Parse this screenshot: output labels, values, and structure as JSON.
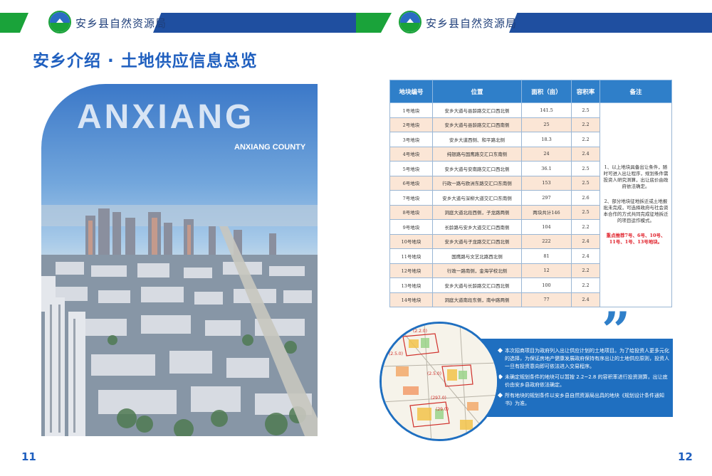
{
  "header": {
    "left_org": "安乡县自然资源局",
    "right_org": "安乡县自然资源局"
  },
  "left_page": {
    "title": "安乡介绍 · 土地供应信息总览",
    "big_word": "ANXIANG",
    "sub_word": "ANXIANG COUNTY",
    "page_number": "11"
  },
  "right_page": {
    "page_number": "12",
    "table": {
      "headers": [
        "地块编号",
        "位置",
        "面积（亩）",
        "容积率",
        "备注"
      ],
      "rows": [
        {
          "id": "1号地块",
          "location": "安乡大道与县龄路交汇口西北侧",
          "area": "141.5",
          "far": "2.5"
        },
        {
          "id": "2号地块",
          "location": "安乡大道与县龄路交汇口西南侧",
          "area": "25",
          "far": "2.2"
        },
        {
          "id": "3号地块",
          "location": "安乡大道西侧、和平路北侧",
          "area": "18.3",
          "far": "2.2"
        },
        {
          "id": "4号地块",
          "location": "纯银路与国鹰路交汇口东南侧",
          "area": "24",
          "far": "2.4"
        },
        {
          "id": "5号地块",
          "location": "安乡大道与安南路交汇口西北侧",
          "area": "36.1",
          "far": "2.5"
        },
        {
          "id": "6号地块",
          "location": "行政一路与欧洲东路交汇口东南侧",
          "area": "153",
          "far": "2.5"
        },
        {
          "id": "7号地块",
          "location": "安乡大道与深柳大道交汇口东南侧",
          "area": "297",
          "far": "2.6"
        },
        {
          "id": "8号地块",
          "location": "洞庭大道北段西侧，子龙路两侧",
          "area": "两块共计146",
          "far": "2.5"
        },
        {
          "id": "9号地块",
          "location": "长龄路与安乡大道交汇口西南侧",
          "area": "104",
          "far": "2.2"
        },
        {
          "id": "10号地块",
          "location": "安乡大道与子龙路交汇口西北侧",
          "area": "222",
          "far": "2.4"
        },
        {
          "id": "11号地块",
          "location": "国鹰路与文艺北路西北侧",
          "area": "81",
          "far": "2.4"
        },
        {
          "id": "12号地块",
          "location": "行政一路南侧，金海学校北侧",
          "area": "12",
          "far": "2.2"
        },
        {
          "id": "13号地块",
          "location": "安乡大道与长龄路交汇口西北侧",
          "area": "100",
          "far": "2.2"
        },
        {
          "id": "14号地块",
          "location": "洞庭大道南段东侧，南中路两侧",
          "area": "77",
          "far": "2.4"
        }
      ],
      "note_1": "1、以上地块具备出让条件，随时可进入出让程序，规划条件需投资人研究测算，出让底价由政府依法确定。",
      "note_2": "2、部分地块征地拆迁或土地报批未完成，可选择政府与社会资本合作的方式共同完成征地拆迁的项目运作模式。",
      "note_3": "重点推荐7号、6号、10号、11号、1号、13号地块。"
    },
    "info_points": [
      "本次招商项目为政府列入出让供应计划的土地项目。为了给投资人更多元化的选择，为保证房地产健康发展政府保持有序出让的土地供应原则，投资人一旦有投资意向即可依法进入交易程序。",
      "未确定规划条件的地块可以暂按 2.2~2.8 的容积率进行投资测算，出让底价由安乡县政府依法确定。",
      "所有地块的规划条件以安乡县自然资源局出具的地块《规划设计条件通知书》为准。"
    ],
    "map_labels": [
      "(2.2.0)",
      "(2.5.0)",
      "(2.5.0)",
      "(297.0)",
      "(29.0)"
    ]
  },
  "colors": {
    "brand_blue": "#1f4fa0",
    "brand_green": "#1aa33a",
    "title_blue": "#1f5fbf",
    "table_header": "#2f7fc9",
    "row_highlight": "#fbe6d6",
    "recommend_red": "#e0202a"
  }
}
